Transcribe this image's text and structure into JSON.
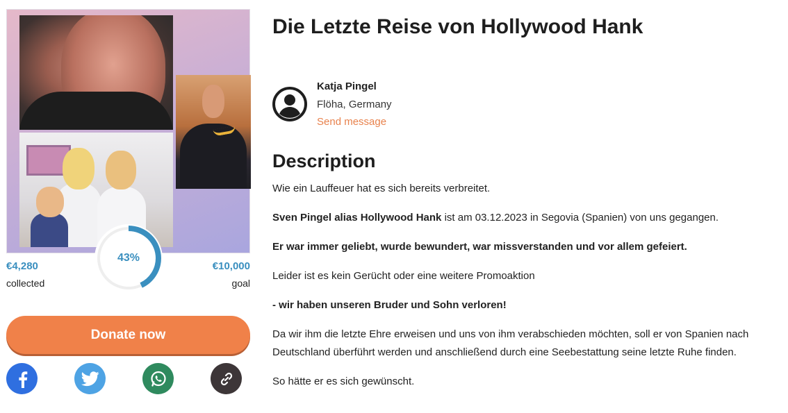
{
  "campaign": {
    "title": "Die Letzte Reise von Hollywood Hank"
  },
  "organizer": {
    "name": "Katja Pingel",
    "location": "Flöha, Germany",
    "message_link": "Send message"
  },
  "funding": {
    "raised": "€4,280",
    "raised_label": "collected",
    "goal": "€10,000",
    "goal_label": "goal",
    "percent_text": "43%",
    "percent": 43
  },
  "actions": {
    "donate_label": "Donate now"
  },
  "share": [
    {
      "name": "facebook-share-button",
      "icon": "facebook-icon",
      "color": "#2f6fe0"
    },
    {
      "name": "twitter-share-button",
      "icon": "twitter-icon",
      "color": "#4ea3e4"
    },
    {
      "name": "whatsapp-share-button",
      "icon": "whatsapp-icon",
      "color": "#2f8a5e"
    },
    {
      "name": "copy-link-button",
      "icon": "link-icon",
      "color": "#3d3638"
    }
  ],
  "description": {
    "heading": "Description",
    "p1": "Wie ein Lauffeuer hat es sich bereits verbreitet.",
    "p2_bold": "Sven Pingel alias Hollywood Hank",
    "p2_rest": " ist am 03.12.2023 in Segovia (Spanien) von uns gegangen.",
    "p3_bold": "Er war immer geliebt, wurde bewundert, war missverstanden und vor allem gefeiert.",
    "p4": "Leider ist es kein Gerücht oder eine weitere Promoaktion",
    "p5_bold": "- wir haben unseren Bruder und Sohn verloren!",
    "p6": "Da wir ihm die letzte Ehre erweisen und uns von ihm verabschieden möchten, soll er von Spanien nach Deutschland überführt werden und anschließend durch eine Seebestattung seine letzte Ruhe finden.",
    "p7": "So hätte er es sich gewünscht."
  },
  "colors": {
    "accent_orange": "#f08149",
    "accent_blue": "#3a8fbf",
    "link_orange": "#e8824d"
  }
}
